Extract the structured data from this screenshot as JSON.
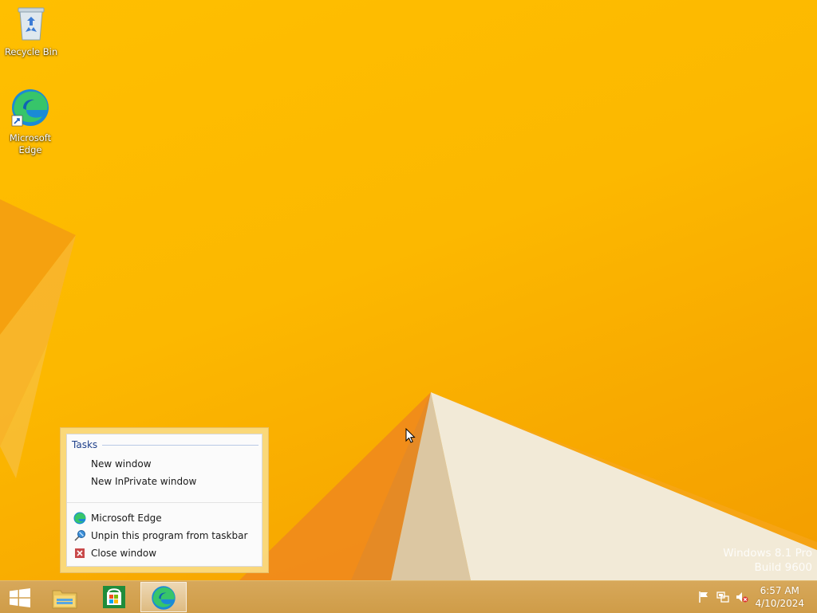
{
  "desktop": {
    "icons": [
      {
        "label": "Recycle Bin",
        "icon": "recycle-bin-icon"
      },
      {
        "label_line1": "Microsoft",
        "label_line2": "Edge",
        "icon": "edge-icon"
      }
    ],
    "watermark": {
      "line1": "Windows 8.1 Pro",
      "line2": "Build 9600"
    }
  },
  "jump_list": {
    "section_title": "Tasks",
    "tasks": [
      {
        "label": "New window"
      },
      {
        "label": "New InPrivate window"
      }
    ],
    "actions": [
      {
        "label": "Microsoft Edge",
        "icon": "edge-icon"
      },
      {
        "label": "Unpin this program from taskbar",
        "icon": "unpin-icon"
      },
      {
        "label": "Close window",
        "icon": "close-icon"
      }
    ]
  },
  "taskbar": {
    "buttons": [
      {
        "name": "start",
        "icon": "windows-logo-icon"
      },
      {
        "name": "file-explorer",
        "icon": "folder-icon"
      },
      {
        "name": "store",
        "icon": "store-icon"
      },
      {
        "name": "edge",
        "icon": "edge-icon",
        "active": true
      }
    ],
    "tray": {
      "icons": [
        "action-center-flag-icon",
        "network-icon",
        "volume-muted-icon"
      ],
      "time": "6:57 AM",
      "date": "4/10/2024"
    }
  },
  "colors": {
    "wallpaper": "#fcb800",
    "taskbar": "#d4a351",
    "jump_border": "#fadb80",
    "section_title": "#1e3f8a"
  }
}
